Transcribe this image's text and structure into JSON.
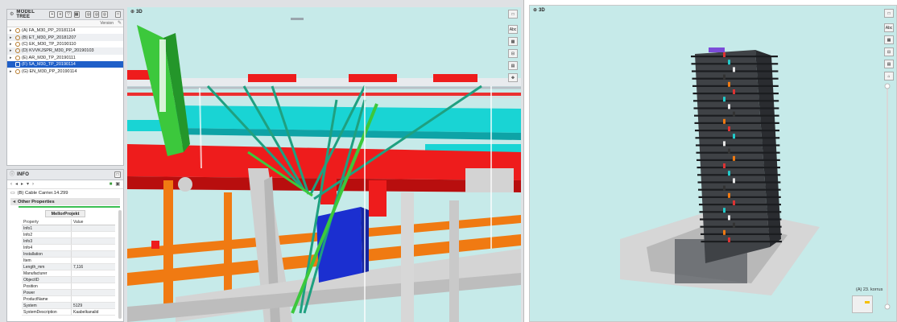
{
  "model_tree": {
    "title": "MODEL TREE",
    "column_version": "Version",
    "items": [
      {
        "label": "(A) FA_M30_PP_20181114"
      },
      {
        "label": "(B) ET_M30_PP_20181207"
      },
      {
        "label": "(C) EK_M30_TP_20190110"
      },
      {
        "label": "(D) KVVKJSPR_M30_PP_20190103"
      },
      {
        "label": "(E) AR_M30_TP_20190111"
      },
      {
        "label": "(F) SA_M30_TP_20190114",
        "selected": true
      },
      {
        "label": "(G) EN_M30_PP_20190114"
      }
    ]
  },
  "info": {
    "title": "INFO",
    "object_name": "(B) Cable Carrier.14.299",
    "section": "Other Properties",
    "group": "MellorProjekt",
    "col_property": "Property",
    "col_value": "Value",
    "properties": [
      {
        "name": "Info1",
        "value": ""
      },
      {
        "name": "Info2",
        "value": ""
      },
      {
        "name": "Info3",
        "value": ""
      },
      {
        "name": "Info4",
        "value": ""
      },
      {
        "name": "Installation",
        "value": ""
      },
      {
        "name": "Item",
        "value": ""
      },
      {
        "name": "Length_mm",
        "value": "7,116"
      },
      {
        "name": "Manufacturer",
        "value": ""
      },
      {
        "name": "ObjectID",
        "value": ""
      },
      {
        "name": "Position",
        "value": ""
      },
      {
        "name": "Power",
        "value": ""
      },
      {
        "name": "ProductName",
        "value": ""
      },
      {
        "name": "System",
        "value": "5129"
      },
      {
        "name": "SystemDescription",
        "value": "Kaabelkanalid"
      }
    ]
  },
  "viewport_left": {
    "title": "3D",
    "text_tool": "Abc"
  },
  "viewport_right": {
    "title": "3D",
    "text_tool": "Abc",
    "floor_label": "(A) 23. korrus"
  },
  "colors": {
    "viewport_bg": "#c6eae9",
    "selection": "#1f5fc8",
    "pipe_red": "#ee1c1c",
    "pipe_orange": "#f07a12",
    "pipe_cyan": "#19d4d4",
    "pipe_grey": "#cfcfcf",
    "cable_green": "#3cc83c",
    "box_blue": "#1b2fd0"
  }
}
